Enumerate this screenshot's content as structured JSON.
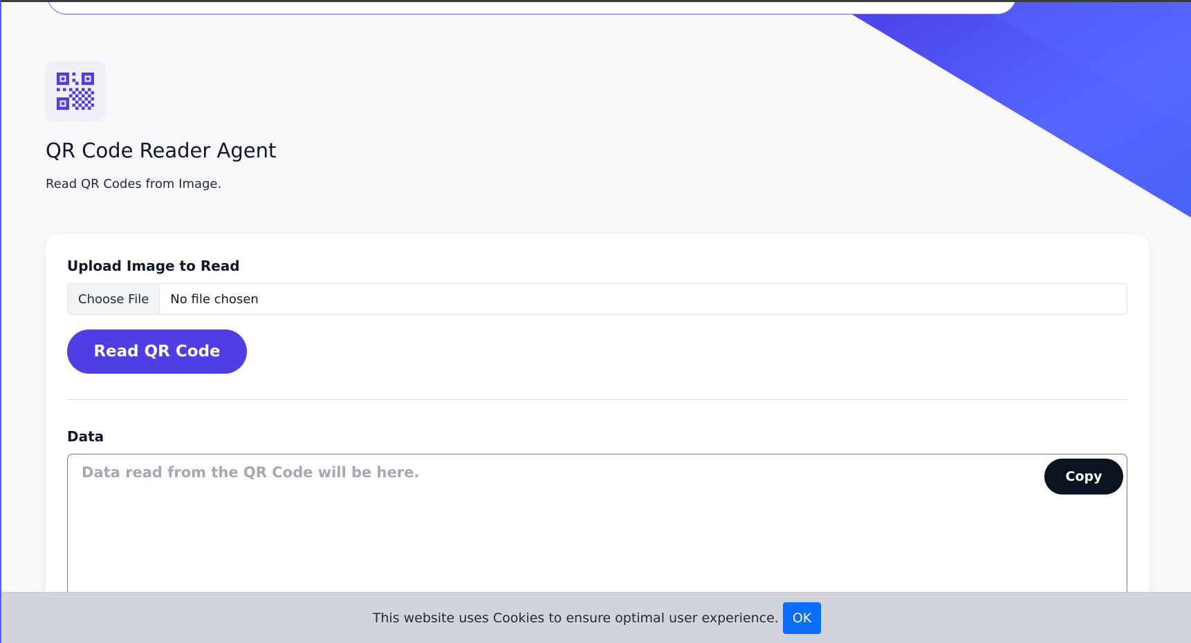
{
  "agent": {
    "icon": "qr-code-icon",
    "title": "QR Code Reader Agent",
    "subtitle": "Read QR Codes from Image."
  },
  "upload": {
    "label": "Upload Image to Read",
    "choose_button": "Choose File",
    "file_status": "No file chosen"
  },
  "actions": {
    "read_button": "Read QR Code"
  },
  "data": {
    "label": "Data",
    "placeholder": "Data read from the QR Code will be here.",
    "value": "",
    "copy_button": "Copy"
  },
  "cookie": {
    "message": "This website uses Cookies to ensure optimal user experience.",
    "ok_button": "OK"
  },
  "colors": {
    "accent": "#4f3ee6",
    "copy_button": "#0b1220",
    "cookie_ok": "#0d6efd",
    "cookie_bar": "#d1d5db"
  }
}
